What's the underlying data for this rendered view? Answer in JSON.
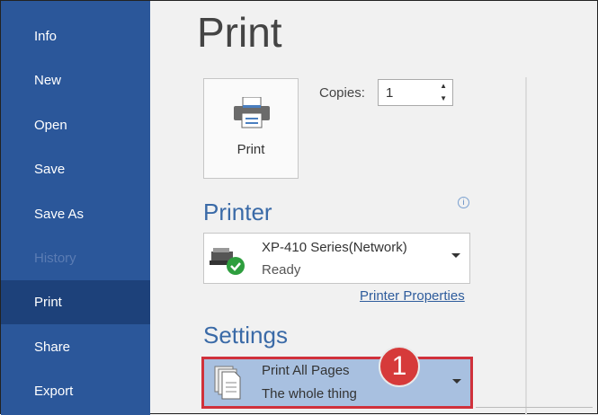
{
  "sidebar": {
    "items": [
      {
        "label": "Info"
      },
      {
        "label": "New"
      },
      {
        "label": "Open"
      },
      {
        "label": "Save"
      },
      {
        "label": "Save As"
      },
      {
        "label": "History"
      },
      {
        "label": "Print"
      },
      {
        "label": "Share"
      },
      {
        "label": "Export"
      }
    ]
  },
  "title": "Print",
  "print_button": "Print",
  "copies": {
    "label": "Copies:",
    "value": "1"
  },
  "printer": {
    "heading": "Printer",
    "name": "XP-410 Series(Network)",
    "status": "Ready",
    "properties_link": "Printer Properties",
    "info_icon": "i"
  },
  "settings": {
    "heading": "Settings",
    "option": "Print All Pages",
    "description": "The whole thing"
  },
  "callout": "1",
  "colors": {
    "sidebar": "#2b579a",
    "selected": "#1d417a",
    "highlight": "#d0313b"
  }
}
